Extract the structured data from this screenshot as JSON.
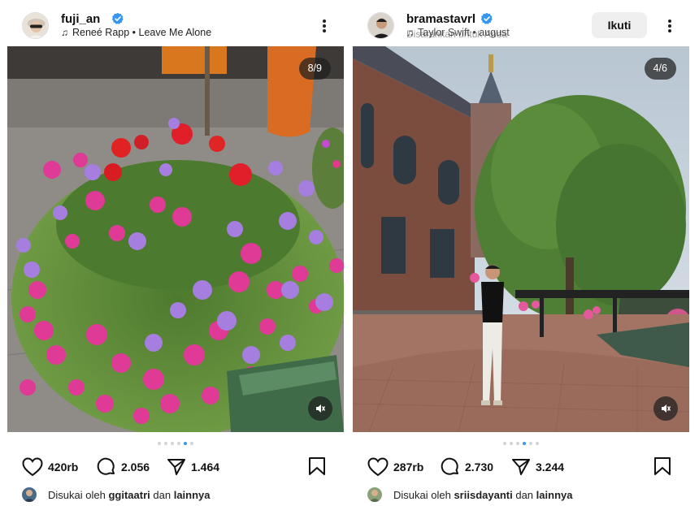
{
  "posts": [
    {
      "username": "fuji_an",
      "music": "Reneé Rapp • Leave Me Alone",
      "counter": "8/9",
      "like_count": "420rb",
      "comment_count": "2.056",
      "share_count": "1.464",
      "likes_prefix": "Disukai oleh",
      "liked_by": "ggitaatri",
      "likes_conjunction": "dan",
      "likes_others": "lainnya",
      "dots_total": 6,
      "dots_active": 4
    },
    {
      "username": "bramastavrl",
      "music": "Taylor Swift • august",
      "subtitle": "Disarankan untuk Anda",
      "follow_label": "Ikuti",
      "counter": "4/6",
      "like_count": "287rb",
      "comment_count": "2.730",
      "share_count": "3.244",
      "likes_prefix": "Disukai oleh",
      "liked_by": "sriisdayanti",
      "likes_conjunction": "dan",
      "likes_others": "lainnya",
      "dots_total": 6,
      "dots_active": 4
    }
  ],
  "colors": {
    "verified": "#3797f0",
    "active_dot": "#3897f0",
    "inactive_dot": "#d4d4d4",
    "follow_bg": "#efefef"
  },
  "icons": [
    "verified-badge-icon",
    "music-note-icon",
    "more-options-icon",
    "heart-icon",
    "comment-icon",
    "share-icon",
    "bookmark-icon",
    "mute-icon"
  ]
}
